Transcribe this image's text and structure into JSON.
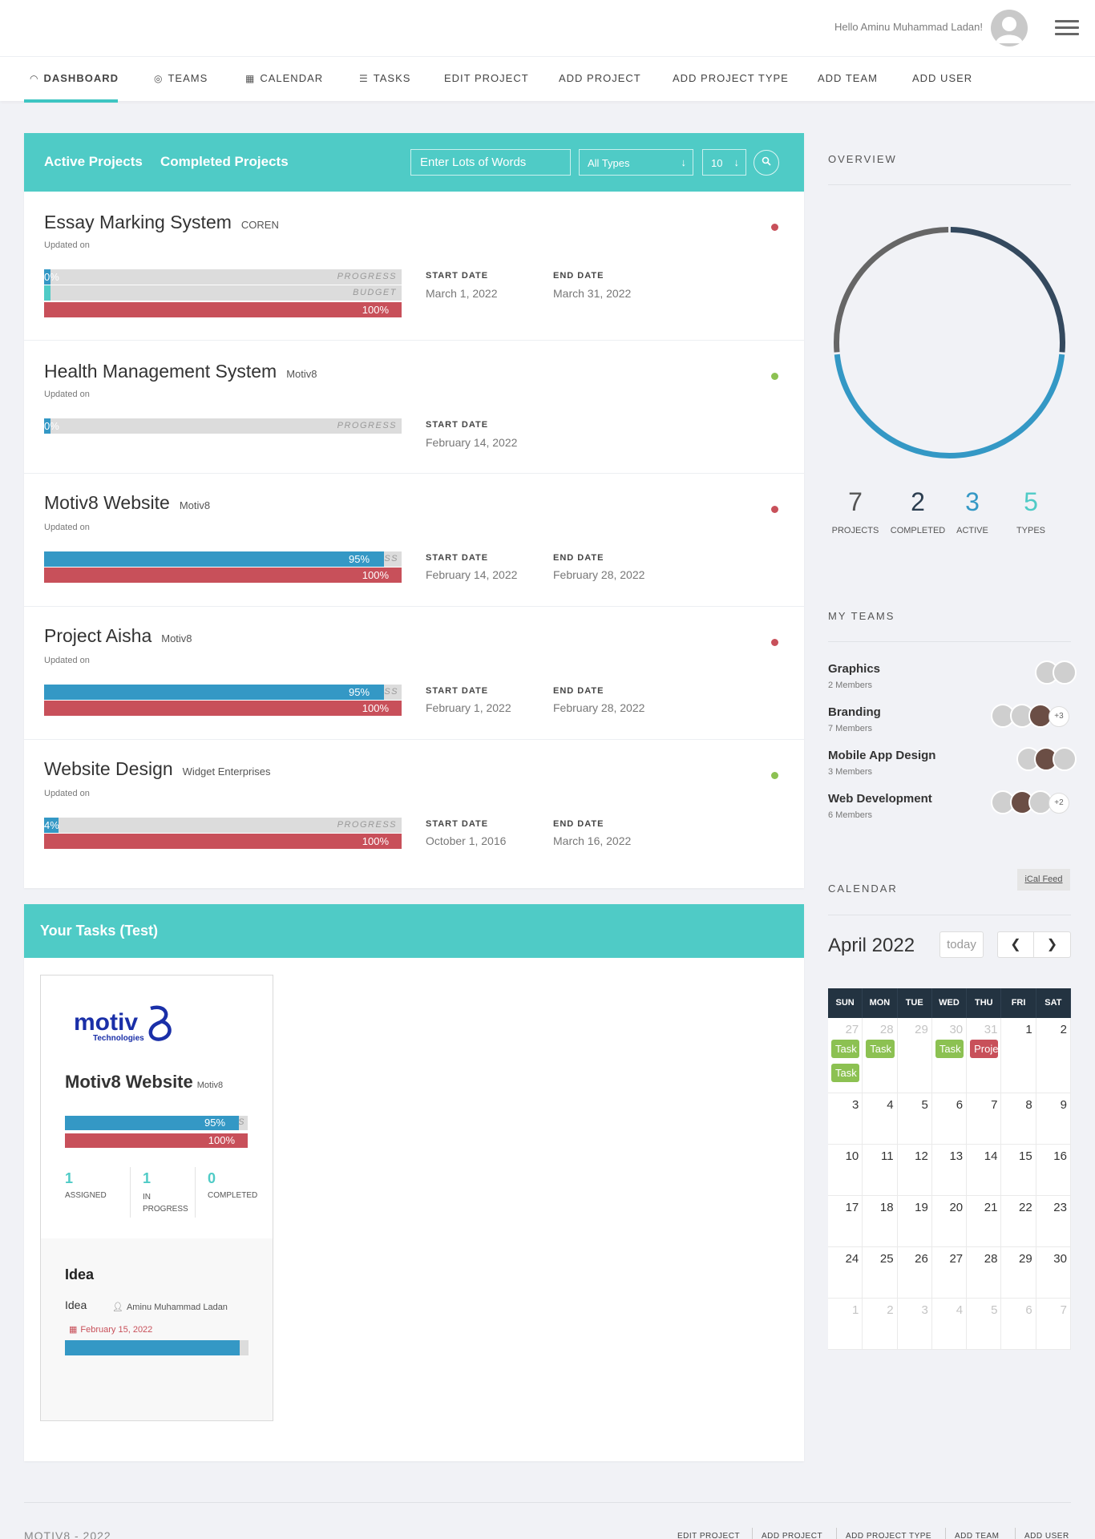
{
  "header": {
    "greeting": "Hello Aminu Muhammad Ladan!",
    "avatar_icon": "user-avatar-icon",
    "menu_icon": "hamburger-icon"
  },
  "nav": {
    "items": [
      {
        "label": "DASHBOARD",
        "icon": "dashboard-gauge-icon",
        "glyph": "◠",
        "active": true
      },
      {
        "label": "TEAMS",
        "icon": "globe-icon",
        "glyph": "◎"
      },
      {
        "label": "CALENDAR",
        "icon": "calendar-icon",
        "glyph": "▦"
      },
      {
        "label": "TASKS",
        "icon": "list-icon",
        "glyph": "☰"
      },
      {
        "label": "EDIT PROJECT"
      },
      {
        "label": "ADD PROJECT"
      },
      {
        "label": "ADD PROJECT TYPE"
      },
      {
        "label": "ADD TEAM"
      },
      {
        "label": "ADD USER"
      }
    ]
  },
  "projects_panel": {
    "tabs": [
      "Active Projects",
      "Completed Projects"
    ],
    "search_placeholder": "Enter Lots of Words",
    "type_select": "All Types",
    "count_select": "10",
    "colors": {
      "teal": "#4fcbc6",
      "blue": "#3498c5",
      "red": "#c8505a",
      "green": "#8cc152"
    }
  },
  "projects": [
    {
      "title": "Essay Marking System",
      "client": "COREN",
      "updated": "Updated on",
      "status": "red",
      "progress_pct": "0%",
      "progress_label": "PROGRESS",
      "budget_label": "BUDGET",
      "time_pct": "100%",
      "start_label": "START DATE",
      "start": "March 1, 2022",
      "end_label": "END DATE",
      "end": "March 31, 2022"
    },
    {
      "title": "Health Management System",
      "client": "Motiv8",
      "updated": "Updated on",
      "status": "green",
      "progress_pct": "0%",
      "progress_label": "PROGRESS",
      "start_label": "START DATE",
      "start": "February 14, 2022"
    },
    {
      "title": "Motiv8 Website",
      "client": "Motiv8",
      "updated": "Updated on",
      "status": "red",
      "progress_pct": "95%",
      "progress_label": "SS",
      "time_pct": "100%",
      "start_label": "START DATE",
      "start": "February 14, 2022",
      "end_label": "END DATE",
      "end": "February 28, 2022"
    },
    {
      "title": "Project Aisha",
      "client": "Motiv8",
      "updated": "Updated on",
      "status": "red",
      "progress_pct": "95%",
      "progress_label": "SS",
      "time_pct": "100%",
      "start_label": "START DATE",
      "start": "February 1, 2022",
      "end_label": "END DATE",
      "end": "February 28, 2022"
    },
    {
      "title": "Website Design",
      "client": "Widget Enterprises",
      "updated": "Updated on",
      "status": "green",
      "progress_pct": "4%",
      "progress_label": "PROGRESS",
      "time_pct": "100%",
      "start_label": "START DATE",
      "start": "October 1, 2016",
      "end_label": "END DATE",
      "end": "March 16, 2022"
    }
  ],
  "tasks_panel": {
    "title": "Your Tasks (Test)",
    "card": {
      "logo_text": "motiv8",
      "logo_sub": "Technologies",
      "project": "Motiv8 Website",
      "client": "Motiv8",
      "progress_pct": "95%",
      "progress_label": "S",
      "time_pct": "100%",
      "stats": [
        {
          "num": "1",
          "label": "ASSIGNED"
        },
        {
          "num": "1",
          "label": "IN PROGRESS"
        },
        {
          "num": "0",
          "label": "COMPLETED"
        }
      ],
      "task_title": "Idea",
      "task_name": "Idea",
      "assignee": "Aminu Muhammad Ladan",
      "due": "February 15, 2022",
      "task_progress": 0.95
    }
  },
  "overview": {
    "title": "OVERVIEW",
    "ring": [
      {
        "name": "active",
        "fraction": 0.265,
        "color": "#34495e"
      },
      {
        "name": "completed",
        "fraction": 0.47,
        "color": "#3498c5"
      },
      {
        "name": "other",
        "fraction": 0.265,
        "color": "#666666"
      }
    ],
    "stats": [
      {
        "num": "7",
        "label": "PROJECTS",
        "color": "#555555"
      },
      {
        "num": "2",
        "label": "COMPLETED",
        "color": "#2c3e50"
      },
      {
        "num": "3",
        "label": "ACTIVE",
        "color": "#3498c5"
      },
      {
        "num": "5",
        "label": "TYPES",
        "color": "#4fcbc6"
      }
    ]
  },
  "teams": {
    "title": "MY TEAMS",
    "items": [
      {
        "name": "Graphics",
        "members": "2 Members"
      },
      {
        "name": "Branding",
        "members": "7 Members",
        "extra": "+3"
      },
      {
        "name": "Mobile App Design",
        "members": "3 Members"
      },
      {
        "name": "Web Development",
        "members": "6 Members",
        "extra": "+2"
      }
    ]
  },
  "calendar": {
    "title": "CALENDAR",
    "ical": "iCal Feed",
    "month": "April 2022",
    "today": "today",
    "prev_icon": "chevron-left-icon",
    "next_icon": "chevron-right-icon",
    "prev_glyph": "❮",
    "next_glyph": "❯",
    "days": [
      "SUN",
      "MON",
      "TUE",
      "WED",
      "THU",
      "FRI",
      "SAT"
    ],
    "weeks": [
      [
        "27",
        "28",
        "29",
        "30",
        "31",
        "1",
        "2"
      ],
      [
        "3",
        "4",
        "5",
        "6",
        "7",
        "8",
        "9"
      ],
      [
        "10",
        "11",
        "12",
        "13",
        "14",
        "15",
        "16"
      ],
      [
        "17",
        "18",
        "19",
        "20",
        "21",
        "22",
        "23"
      ],
      [
        "24",
        "25",
        "26",
        "27",
        "28",
        "29",
        "30"
      ],
      [
        "1",
        "2",
        "3",
        "4",
        "5",
        "6",
        "7"
      ]
    ],
    "events": [
      {
        "label": "Task",
        "col": 0,
        "slot": 0,
        "color": "#8cc152"
      },
      {
        "label": "Task",
        "col": 0,
        "slot": 1,
        "color": "#8cc152"
      },
      {
        "label": "Task",
        "col": 1,
        "slot": 0,
        "color": "#8cc152"
      },
      {
        "label": "Task",
        "col": 3,
        "slot": 0,
        "color": "#8cc152"
      },
      {
        "label": "Proje",
        "col": 4,
        "slot": 0,
        "color": "#c8505a"
      }
    ]
  },
  "footer": {
    "copyright": "MOTIV8 - 2022",
    "links": [
      "EDIT PROJECT",
      "ADD PROJECT",
      "ADD PROJECT TYPE",
      "ADD TEAM",
      "ADD USER"
    ]
  }
}
